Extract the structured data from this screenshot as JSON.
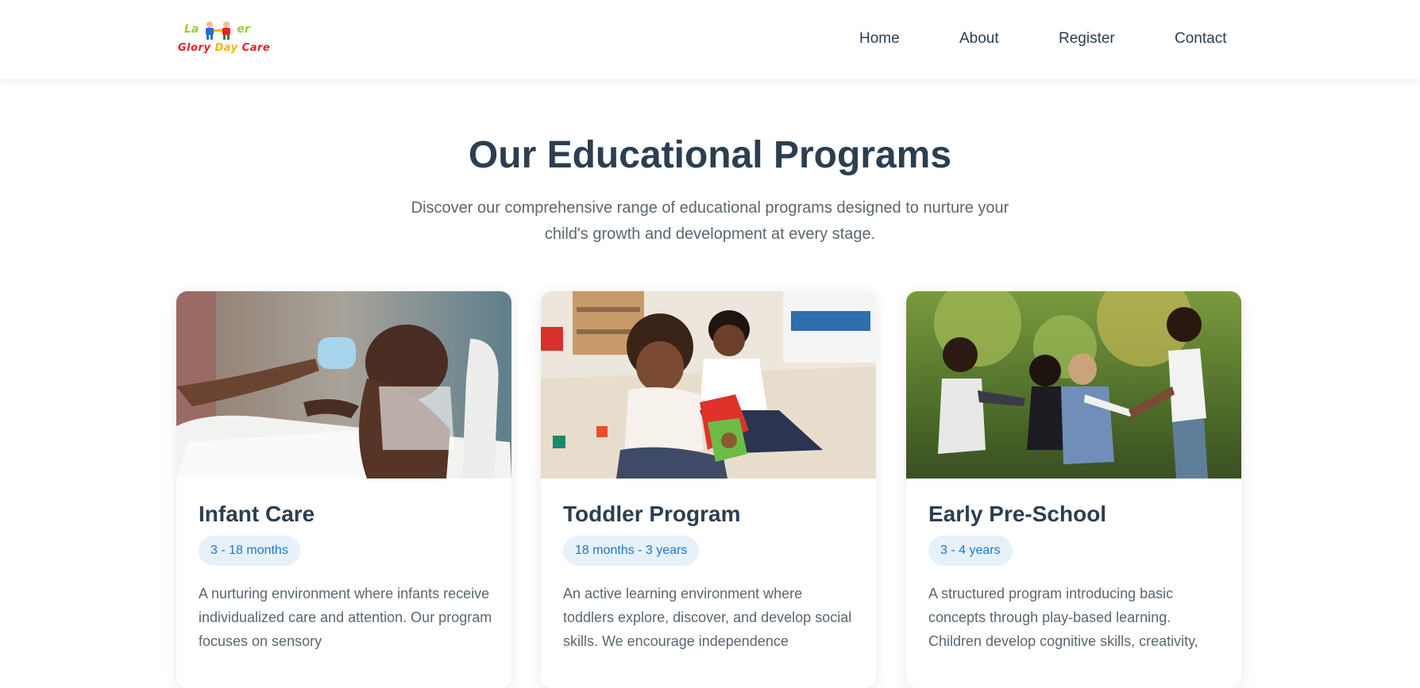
{
  "site": {
    "logo": {
      "line1_left": "La",
      "line1_right": "er",
      "line2_word1": "Glory",
      "line2_word2": "Day",
      "line2_word3": "Care"
    }
  },
  "nav": {
    "items": [
      {
        "label": "Home"
      },
      {
        "label": "About"
      },
      {
        "label": "Register"
      },
      {
        "label": "Contact"
      }
    ]
  },
  "programs": {
    "title": "Our Educational Programs",
    "subtitle": "Discover our comprehensive range of educational programs designed to nurture your child's growth and development at every stage.",
    "cards": [
      {
        "title": "Infant Care",
        "age": "3 - 18 months",
        "description": "A nurturing environment where infants receive individualized care and attention. Our program focuses on sensory",
        "image": "photo-infant-drinking-bottle"
      },
      {
        "title": "Toddler Program",
        "age": "18 months - 3 years",
        "description": "An active learning environment where toddlers explore, discover, and develop social skills. We encourage independence",
        "image": "photo-toddlers-playing-with-shape-sorter"
      },
      {
        "title": "Early Pre-School",
        "age": "3 - 4 years",
        "description": "A structured program introducing basic concepts through play-based learning. Children develop cognitive skills, creativity,",
        "image": "photo-children-playing-in-circle-outdoors"
      }
    ]
  },
  "colors": {
    "heading": "#2c3e50",
    "body_text": "#5b6670",
    "badge_bg": "#e6f1fb",
    "badge_text": "#1f78c8",
    "logo_green": "#9acd32",
    "logo_red": "#e0242b",
    "logo_yellow": "#f7b500"
  }
}
